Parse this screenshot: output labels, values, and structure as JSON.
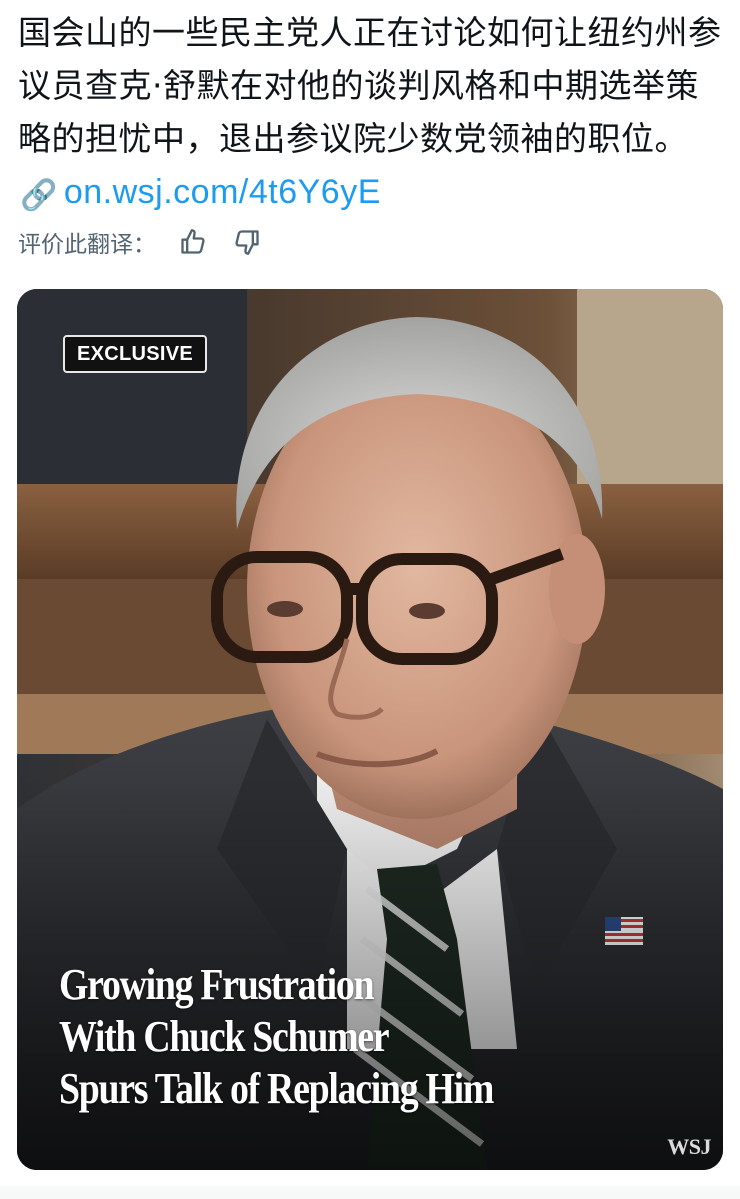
{
  "post": {
    "text_before_link": "国会山的一些民主党人正在讨论如何让纽约州参议员查克·舒默在对他的谈判风格和中期选举策略的担忧中，退出参议院少数党领袖的职位。",
    "link_text": "on.wsj.com/4t6Y6yE"
  },
  "rating": {
    "label": "评价此翻译：",
    "thumbs_up_icon": "thumbs-up-icon",
    "thumbs_down_icon": "thumbs-down-icon"
  },
  "media": {
    "badge": "EXCLUSIVE",
    "headline_lines": [
      "Growing Frustration",
      "With Chuck Schumer",
      "Spurs Talk of Replacing Him"
    ],
    "source_mark": "WSJ"
  },
  "colors": {
    "link": "#1d9bf0",
    "text": "#0f1419",
    "muted": "#536471"
  }
}
